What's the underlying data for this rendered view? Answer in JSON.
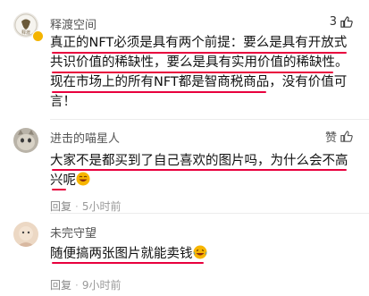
{
  "comments": [
    {
      "username": "释渡空间",
      "likes": "3",
      "lines": [
        "真正的NFT必须是具有两个前提：要么是具有开放式",
        "共识价值的稀缺性，要么是具有实用价值的稀缺性。",
        "现在市场上的所有NFT都是智商税商品，没有价值可",
        "言！"
      ],
      "reply_label": "",
      "time": ""
    },
    {
      "username": "进击的喵星人",
      "likes": "赞",
      "lines": [
        "大家不是都买到了自己喜欢的图片吗，为什么会不高",
        "兴呢"
      ],
      "reply_label": "回复",
      "time": "5小时前"
    },
    {
      "username": "未完守望",
      "likes": "",
      "lines": [
        "随便搞两张图片就能卖钱"
      ],
      "reply_label": "回复",
      "time": "9小时前"
    }
  ],
  "colors": {
    "underline": "#e8003d",
    "muted": "#999999"
  },
  "icons": [
    "thumb-up-icon",
    "grin-emoji",
    "laughing-tears-emoji"
  ]
}
